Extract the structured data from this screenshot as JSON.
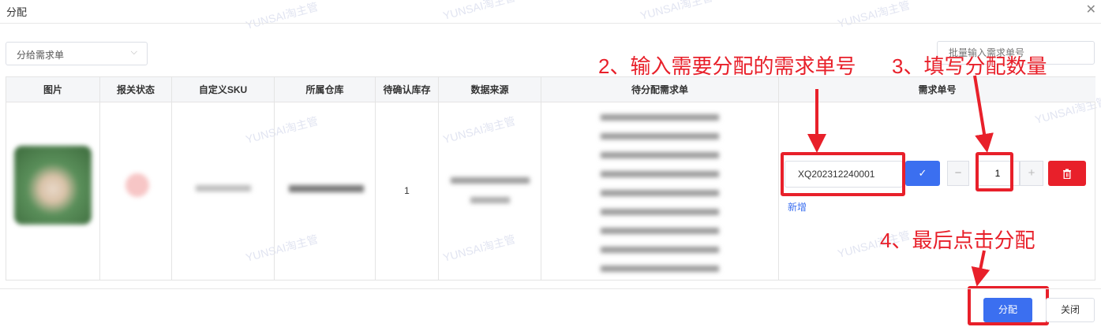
{
  "dialog": {
    "title": "分配",
    "close_icon": "close-icon"
  },
  "toolbar": {
    "select_value": "分给需求单",
    "batch_placeholder": "批量输入需求单号"
  },
  "table": {
    "headers": [
      "图片",
      "报关状态",
      "自定义SKU",
      "所属仓库",
      "待确认库存",
      "数据来源",
      "待分配需求单",
      "需求单号"
    ],
    "row": {
      "pending_stock": "1"
    }
  },
  "assign": {
    "request_no": "XQ202312240001",
    "confirm_icon": "check-icon",
    "quantity": "1",
    "minus": "−",
    "plus": "+",
    "delete_icon": "trash-icon",
    "add_link": "新增"
  },
  "annotations": {
    "step2": "2、输入需要分配的需求单号",
    "step3": "3、填写分配数量",
    "step4": "4、最后点击分配"
  },
  "footer": {
    "assign_button": "分配",
    "close_button": "关闭"
  },
  "watermark": "YUNSAI淘主管",
  "colors": {
    "primary": "#3b6ff0",
    "danger": "#e8202a",
    "annotation": "#e8202a"
  }
}
